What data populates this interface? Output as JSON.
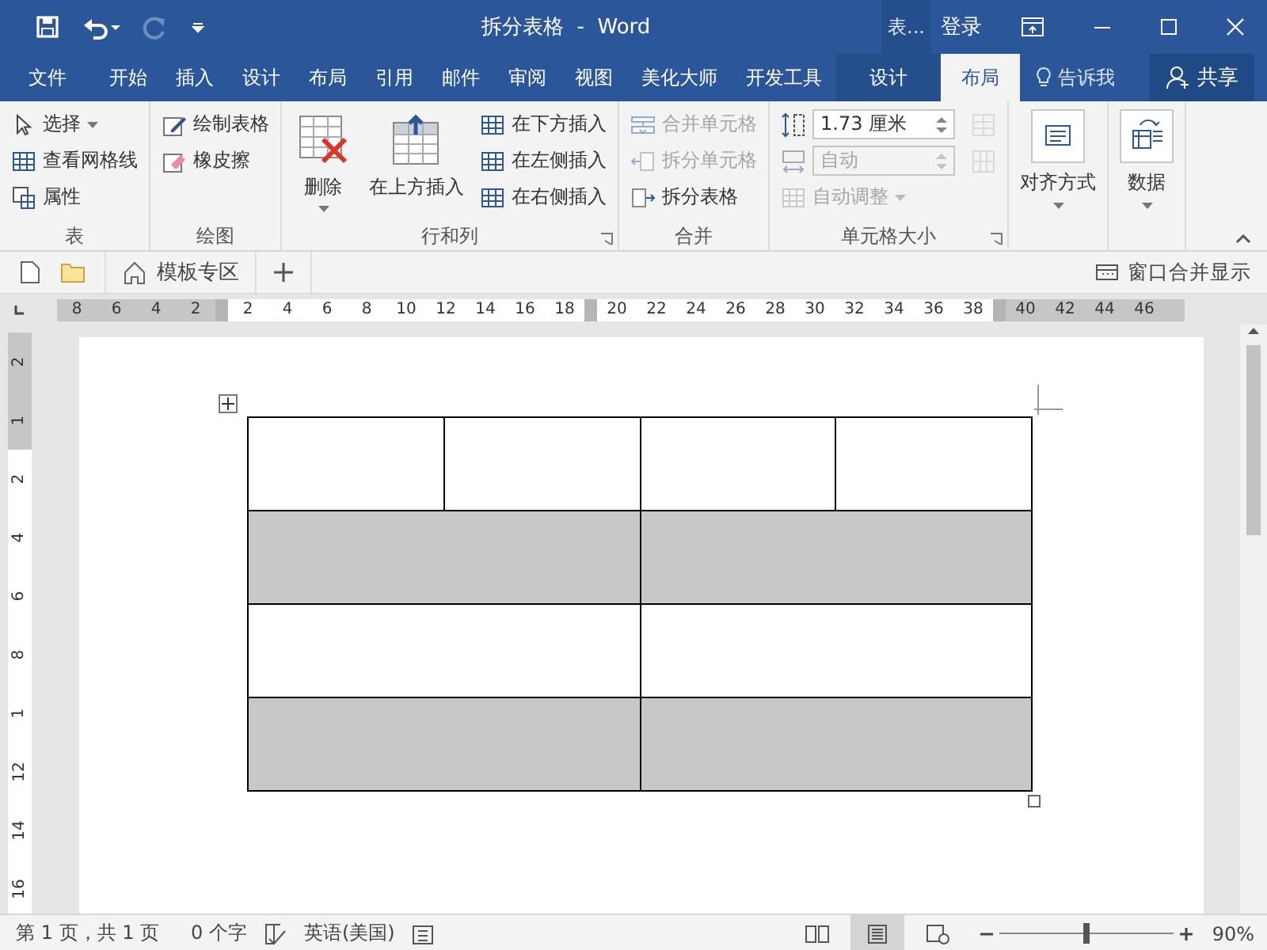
{
  "title_bar": {
    "title": "拆分表格  -  Word",
    "context_label": "表...",
    "sign_in": "登录"
  },
  "menu_tabs": [
    {
      "label": "文件",
      "selected": false,
      "kind": "file"
    },
    {
      "label": "开始",
      "selected": false,
      "kind": "normal"
    },
    {
      "label": "插入",
      "selected": false,
      "kind": "normal"
    },
    {
      "label": "设计",
      "selected": false,
      "kind": "normal"
    },
    {
      "label": "布局",
      "selected": false,
      "kind": "normal"
    },
    {
      "label": "引用",
      "selected": false,
      "kind": "normal"
    },
    {
      "label": "邮件",
      "selected": false,
      "kind": "normal"
    },
    {
      "label": "审阅",
      "selected": false,
      "kind": "normal"
    },
    {
      "label": "视图",
      "selected": false,
      "kind": "normal"
    },
    {
      "label": "美化大师",
      "selected": false,
      "kind": "normal"
    },
    {
      "label": "开发工具",
      "selected": false,
      "kind": "normal"
    },
    {
      "label": "设计",
      "selected": false,
      "kind": "contextual"
    },
    {
      "label": "布局",
      "selected": true,
      "kind": "contextual"
    }
  ],
  "tell_me": "告诉我",
  "share": "共享",
  "ribbon": [
    {
      "label": "表",
      "launcher": false,
      "columns": [
        [
          {
            "kind": "small",
            "label": "选择",
            "dropdown": true,
            "disabled": false
          },
          {
            "kind": "small",
            "label": "查看网格线",
            "dropdown": false,
            "disabled": false
          },
          {
            "kind": "small",
            "label": "属性",
            "dropdown": false,
            "disabled": false
          }
        ]
      ]
    },
    {
      "label": "绘图",
      "launcher": false,
      "columns": [
        [
          {
            "kind": "small",
            "label": "绘制表格",
            "dropdown": false,
            "disabled": false
          },
          {
            "kind": "small",
            "label": "橡皮擦",
            "dropdown": false,
            "disabled": false
          }
        ]
      ]
    },
    {
      "label": "行和列",
      "launcher": true,
      "columns": [
        [
          {
            "kind": "large",
            "label": "删除",
            "dropdown": true,
            "disabled": false
          }
        ],
        [
          {
            "kind": "large",
            "label": "在上方插入",
            "dropdown": false,
            "disabled": false
          }
        ],
        [
          {
            "kind": "small",
            "label": "在下方插入",
            "dropdown": false,
            "disabled": false
          },
          {
            "kind": "small",
            "label": "在左侧插入",
            "dropdown": false,
            "disabled": false
          },
          {
            "kind": "small",
            "label": "在右侧插入",
            "dropdown": false,
            "disabled": false
          }
        ]
      ]
    },
    {
      "label": "合并",
      "launcher": false,
      "columns": [
        [
          {
            "kind": "small",
            "label": "合并单元格",
            "dropdown": false,
            "disabled": true
          },
          {
            "kind": "small",
            "label": "拆分单元格",
            "dropdown": false,
            "disabled": true
          },
          {
            "kind": "small",
            "label": "拆分表格",
            "dropdown": false,
            "disabled": false
          }
        ]
      ]
    },
    {
      "label": "单元格大小",
      "launcher": true,
      "columns": [
        [
          {
            "kind": "field",
            "value": "1.73 厘米",
            "disabled": false
          },
          {
            "kind": "field",
            "value": "自动",
            "disabled": true
          },
          {
            "kind": "small",
            "label": "自动调整",
            "dropdown": true,
            "disabled": true
          }
        ],
        [
          {
            "kind": "icon",
            "disabled": true
          },
          {
            "kind": "icon",
            "disabled": true
          }
        ]
      ]
    },
    {
      "launcher": false,
      "columns": [
        [
          {
            "kind": "framed",
            "label": "对齐方式",
            "dropdown": true,
            "disabled": false
          }
        ]
      ]
    },
    {
      "launcher": false,
      "columns": [
        [
          {
            "kind": "framed",
            "label": "数据",
            "dropdown": true,
            "disabled": false
          }
        ]
      ]
    }
  ],
  "doc_tabs": [
    {
      "label": "模板专区",
      "selected": false
    }
  ],
  "window_merge": "窗口合并显示",
  "h_ruler": [
    {
      "kind": "num",
      "label": "8",
      "margin": true
    },
    {
      "kind": "num",
      "label": "6",
      "margin": true
    },
    {
      "kind": "num",
      "label": "4",
      "margin": true
    },
    {
      "kind": "num",
      "label": "2",
      "margin": true
    },
    {
      "kind": "marker"
    },
    {
      "kind": "num",
      "label": "2",
      "margin": false
    },
    {
      "kind": "num",
      "label": "4",
      "margin": false
    },
    {
      "kind": "num",
      "label": "6",
      "margin": false
    },
    {
      "kind": "num",
      "label": "8",
      "margin": false
    },
    {
      "kind": "num",
      "label": "10",
      "margin": false
    },
    {
      "kind": "num",
      "label": "12",
      "margin": false
    },
    {
      "kind": "num",
      "label": "14",
      "margin": false
    },
    {
      "kind": "num",
      "label": "16",
      "margin": false
    },
    {
      "kind": "num",
      "label": "18",
      "margin": false
    },
    {
      "kind": "marker"
    },
    {
      "kind": "num",
      "label": "20",
      "margin": false
    },
    {
      "kind": "num",
      "label": "22",
      "margin": false
    },
    {
      "kind": "num",
      "label": "24",
      "margin": false
    },
    {
      "kind": "num",
      "label": "26",
      "margin": false
    },
    {
      "kind": "num",
      "label": "28",
      "margin": false
    },
    {
      "kind": "num",
      "label": "30",
      "margin": false
    },
    {
      "kind": "num",
      "label": "32",
      "margin": false
    },
    {
      "kind": "num",
      "label": "34",
      "margin": false
    },
    {
      "kind": "num",
      "label": "36",
      "margin": false
    },
    {
      "kind": "num",
      "label": "38",
      "margin": false
    },
    {
      "kind": "marker"
    },
    {
      "kind": "num",
      "label": "40",
      "margin": true
    },
    {
      "kind": "num",
      "label": "42",
      "margin": true
    },
    {
      "kind": "num",
      "label": "44",
      "margin": true
    },
    {
      "kind": "num",
      "label": "46",
      "margin": true
    }
  ],
  "v_ruler": [
    {
      "label": "2",
      "margin": true
    },
    {
      "label": "1",
      "margin": true
    },
    {
      "label": "2",
      "margin": false
    },
    {
      "label": "4",
      "margin": false
    },
    {
      "label": "6",
      "margin": false
    },
    {
      "label": "8",
      "margin": false
    },
    {
      "label": "1",
      "margin": false
    },
    {
      "label": "12",
      "margin": false
    },
    {
      "label": "14",
      "margin": false
    },
    {
      "label": "16",
      "margin": false
    }
  ],
  "table": {
    "rows": [
      {
        "cells": [
          {
            "shaded": false
          },
          {
            "shaded": false
          },
          {
            "shaded": false
          },
          {
            "shaded": false
          }
        ]
      },
      {
        "cells": [
          {
            "shaded": true
          },
          {
            "shaded": true
          }
        ]
      },
      {
        "cells": [
          {
            "shaded": false
          },
          {
            "shaded": false
          }
        ]
      },
      {
        "cells": [
          {
            "shaded": true
          },
          {
            "shaded": true
          }
        ]
      }
    ]
  },
  "status_bar": {
    "page": "第 1 页，共 1 页",
    "word_count": "0 个字",
    "language": "英语(美国)",
    "views": [
      {
        "selected": false
      },
      {
        "selected": true
      },
      {
        "selected": false
      }
    ],
    "zoom": {
      "level": 0.5,
      "reading": "90%"
    }
  }
}
